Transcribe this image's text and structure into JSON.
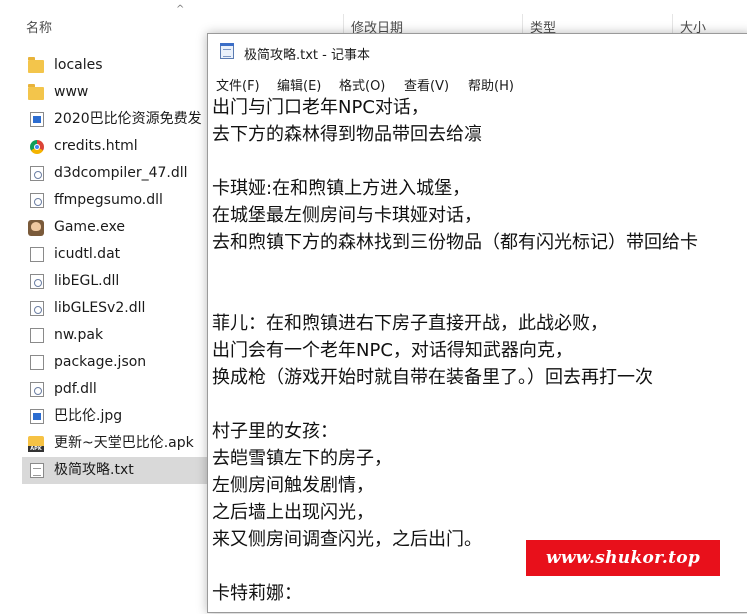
{
  "explorer": {
    "columns": {
      "name": "名称",
      "modified": "修改日期",
      "type": "类型",
      "size": "大小"
    },
    "files": [
      {
        "name": "locales",
        "icon": "folder-icon"
      },
      {
        "name": "www",
        "icon": "folder-icon"
      },
      {
        "name": "2020巴比伦资源免费发",
        "icon": "image-file-icon"
      },
      {
        "name": "credits.html",
        "icon": "chrome-icon"
      },
      {
        "name": "d3dcompiler_47.dll",
        "icon": "dll-file-icon"
      },
      {
        "name": "ffmpegsumo.dll",
        "icon": "dll-file-icon"
      },
      {
        "name": "Game.exe",
        "icon": "game-app-icon"
      },
      {
        "name": "icudtl.dat",
        "icon": "blank-file-icon"
      },
      {
        "name": "libEGL.dll",
        "icon": "dll-file-icon"
      },
      {
        "name": "libGLESv2.dll",
        "icon": "dll-file-icon"
      },
      {
        "name": "nw.pak",
        "icon": "blank-file-icon"
      },
      {
        "name": "package.json",
        "icon": "blank-file-icon"
      },
      {
        "name": "pdf.dll",
        "icon": "dll-file-icon"
      },
      {
        "name": "巴比伦.jpg",
        "icon": "image-file-icon"
      },
      {
        "name": "更新~天堂巴比伦.apk",
        "icon": "apk-file-icon"
      },
      {
        "name": "极简攻略.txt",
        "icon": "text-file-icon",
        "selected": true
      }
    ]
  },
  "notepad": {
    "title": "极简攻略.txt - 记事本",
    "menu": [
      "文件(F)",
      "编辑(E)",
      "格式(O)",
      "查看(V)",
      "帮助(H)"
    ],
    "lines": [
      "出门与门口老年NPC对话，",
      "去下方的森林得到物品带回去给凛",
      "",
      "卡琪娅:在和煦镇上方进入城堡，",
      "在城堡最左侧房间与卡琪娅对话，",
      "去和煦镇下方的森林找到三份物品（都有闪光标记）带回给卡",
      "",
      "",
      "菲儿：在和煦镇进右下房子直接开战，此战必败，",
      "出门会有一个老年NPC，对话得知武器向克，",
      "换成枪（游戏开始时就自带在装备里了。）回去再打一次",
      "",
      "村子里的女孩：",
      "去皑雪镇左下的房子，",
      "左侧房间触发剧情，",
      "之后墙上出现闪光，",
      "来又侧房间调查闪光，之后出门。",
      "",
      "卡特莉娜："
    ]
  },
  "watermark": {
    "text": "www.shukor.top",
    "color": "#e8101b"
  }
}
